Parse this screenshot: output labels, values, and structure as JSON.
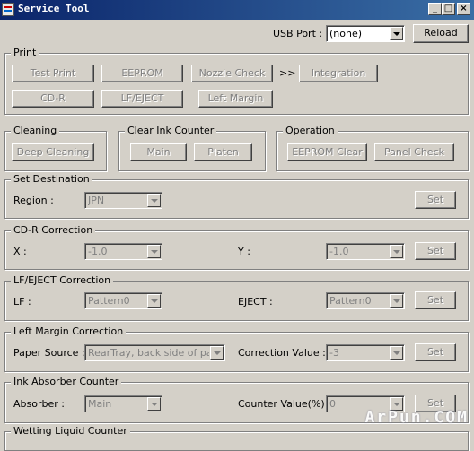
{
  "window": {
    "title": "Service Tool"
  },
  "usb": {
    "label": "USB Port :",
    "value": "(none)",
    "reload": "Reload"
  },
  "print": {
    "title": "Print",
    "test_print": "Test Print",
    "eeprom": "EEPROM",
    "nozzle_check": "Nozzle Check",
    "arrow": ">>",
    "integration": "Integration",
    "cd_r": "CD-R",
    "lf_eject": "LF/EJECT",
    "left_margin": "Left Margin"
  },
  "cleaning": {
    "title": "Cleaning",
    "deep_cleaning": "Deep Cleaning"
  },
  "clear_ink_counter": {
    "title": "Clear Ink Counter",
    "main": "Main",
    "platen": "Platen"
  },
  "operation": {
    "title": "Operation",
    "eeprom_clear": "EEPROM Clear",
    "panel_check": "Panel Check"
  },
  "set_destination": {
    "title": "Set Destination",
    "region_label": "Region :",
    "region_value": "JPN",
    "set": "Set"
  },
  "cdr_correction": {
    "title": "CD-R Correction",
    "x_label": "X :",
    "x_value": "-1.0",
    "y_label": "Y :",
    "y_value": "-1.0",
    "set": "Set"
  },
  "lf_eject_correction": {
    "title": "LF/EJECT Correction",
    "lf_label": "LF :",
    "lf_value": "Pattern0",
    "eject_label": "EJECT :",
    "eject_value": "Pattern0",
    "set": "Set"
  },
  "left_margin_correction": {
    "title": "Left Margin Correction",
    "paper_label": "Paper Source :",
    "paper_value": "RearTray, back side of pap",
    "corr_label": "Correction Value :",
    "corr_value": "-3",
    "set": "Set"
  },
  "ink_absorber": {
    "title": "Ink Absorber Counter",
    "absorber_label": "Absorber :",
    "absorber_value": "Main",
    "counter_label": "Counter Value(%) :",
    "counter_value": "0",
    "set": "Set"
  },
  "wetting": {
    "title": "Wetting Liquid Counter"
  },
  "watermark": "ArPun.COM"
}
